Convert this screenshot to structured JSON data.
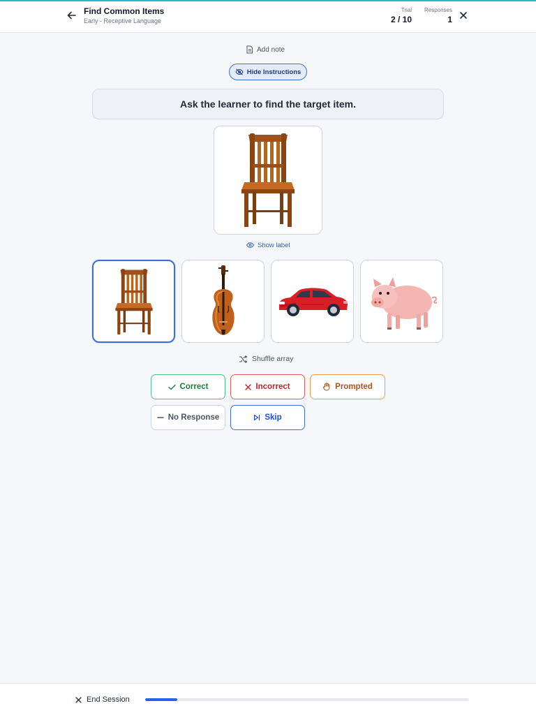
{
  "header": {
    "title": "Find Common Items",
    "subtitle": "Early - Receptive Language",
    "trial_label": "Trial",
    "trial_value": "2 / 10",
    "responses_label": "Responses",
    "responses_value": "1",
    "back_icon": "arrow-left-icon",
    "close_icon": "close-icon"
  },
  "actions": {
    "add_note": "Add note",
    "hide_instructions": "Hide Instructions",
    "show_label": "Show label",
    "shuffle": "Shuffle array"
  },
  "instruction": "Ask the learner to find the target item.",
  "target": {
    "item": "chair"
  },
  "choices": [
    {
      "item": "chair",
      "selected": true
    },
    {
      "item": "violin",
      "selected": false
    },
    {
      "item": "car",
      "selected": false
    },
    {
      "item": "pig",
      "selected": false
    }
  ],
  "responses": {
    "correct": "Correct",
    "incorrect": "Incorrect",
    "prompted": "Prompted",
    "no_response": "No Response",
    "skip": "Skip"
  },
  "footer": {
    "end_session": "End Session",
    "progress_fraction": 0.1
  },
  "colors": {
    "accent": "#2563eb",
    "top_bar": "#22b8cf",
    "correct": "#16803c",
    "incorrect": "#c02626",
    "prompted": "#b4531a",
    "skip": "#1d4ed8"
  }
}
